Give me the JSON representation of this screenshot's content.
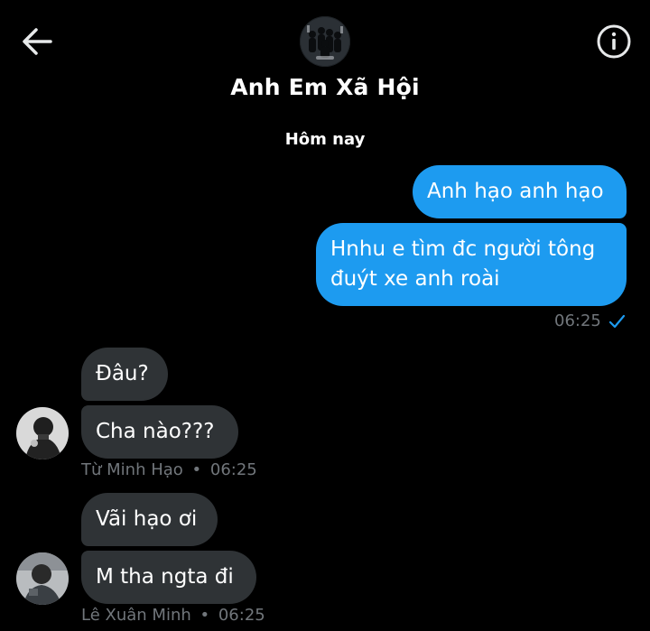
{
  "header": {
    "title": "Anh Em Xã Hội",
    "back_icon": "arrow-left-icon",
    "info_icon": "info-circle-icon",
    "avatar_icon": "group-avatar"
  },
  "date_separator": "Hôm nay",
  "outgoing": {
    "messages": [
      "Anh hạo anh hạo",
      "Hnhu e tìm đc người tông",
      "đuýt xe anh roài"
    ],
    "time": "06:25",
    "status_icon": "check-icon",
    "accent": "#1d9bf0"
  },
  "incoming": [
    {
      "sender": "Từ Minh Hạo",
      "time": "06:25",
      "messages": [
        "Đâu?",
        "Cha nào???"
      ]
    },
    {
      "sender": "Lê Xuân Minh",
      "time": "06:25",
      "messages": [
        "Vãi hạo ơi",
        "M tha ngta đi"
      ]
    }
  ],
  "separator": "•"
}
